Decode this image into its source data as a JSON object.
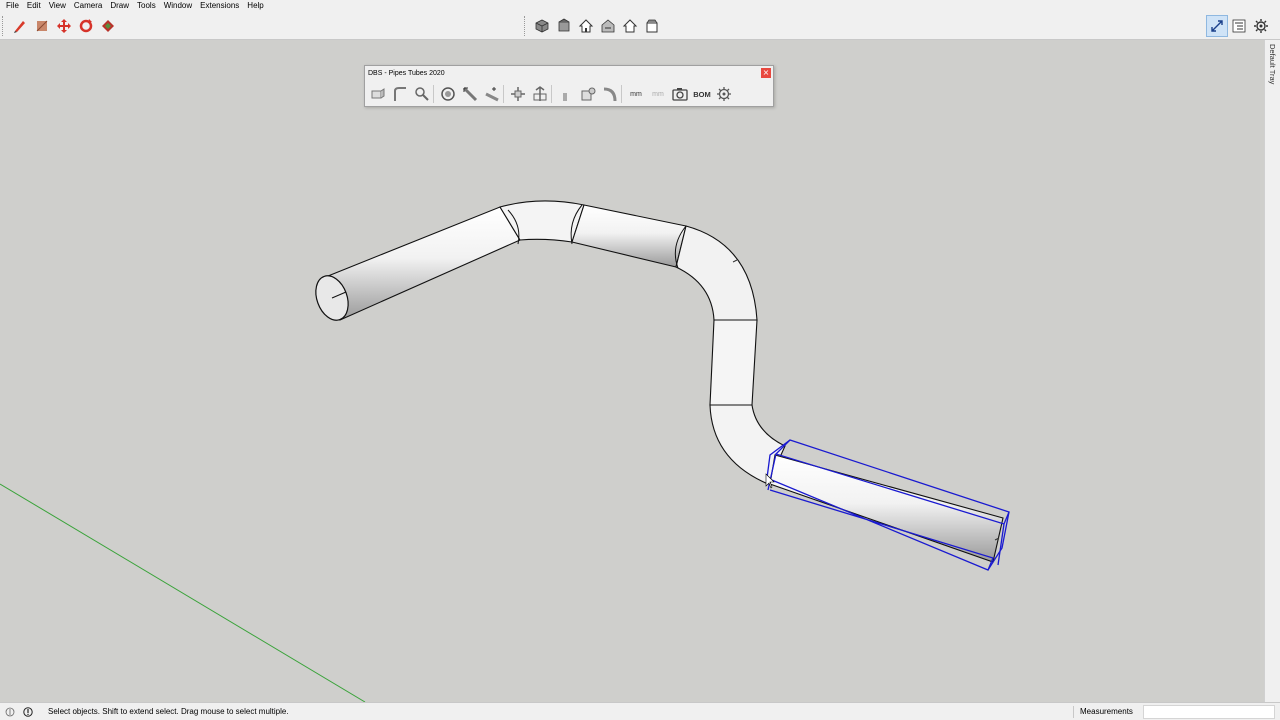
{
  "menu": {
    "items": [
      "File",
      "Edit",
      "View",
      "Camera",
      "Draw",
      "Tools",
      "Window",
      "Extensions",
      "Help"
    ]
  },
  "toolbar": {
    "left_icons": [
      "pencil-icon",
      "eraser-icon",
      "move-icon",
      "rotate-icon",
      "paint-bucket-icon"
    ],
    "center_icons": [
      "iso-view-icon",
      "top-view-icon",
      "front-view-icon",
      "right-view-icon",
      "back-view-icon"
    ],
    "right_icons": [
      "zoom-extents-icon",
      "outliner-icon",
      "settings-icon"
    ]
  },
  "tray": {
    "label": "Default Tray"
  },
  "panel": {
    "title": "DBS - Pipes Tubes 2020",
    "close": "×",
    "unit_label_1": "mm",
    "unit_label_2": "mm",
    "bom_label": "BOM"
  },
  "status": {
    "text": "Select objects. Shift to extend select. Drag mouse to select multiple.",
    "measurements_label": "Measurements",
    "measurements_value": ""
  },
  "colors": {
    "background": "#cfcfcc",
    "selection": "#1a1ad0",
    "axis_green": "#3aa33a",
    "chrome": "#f0f0f0"
  }
}
